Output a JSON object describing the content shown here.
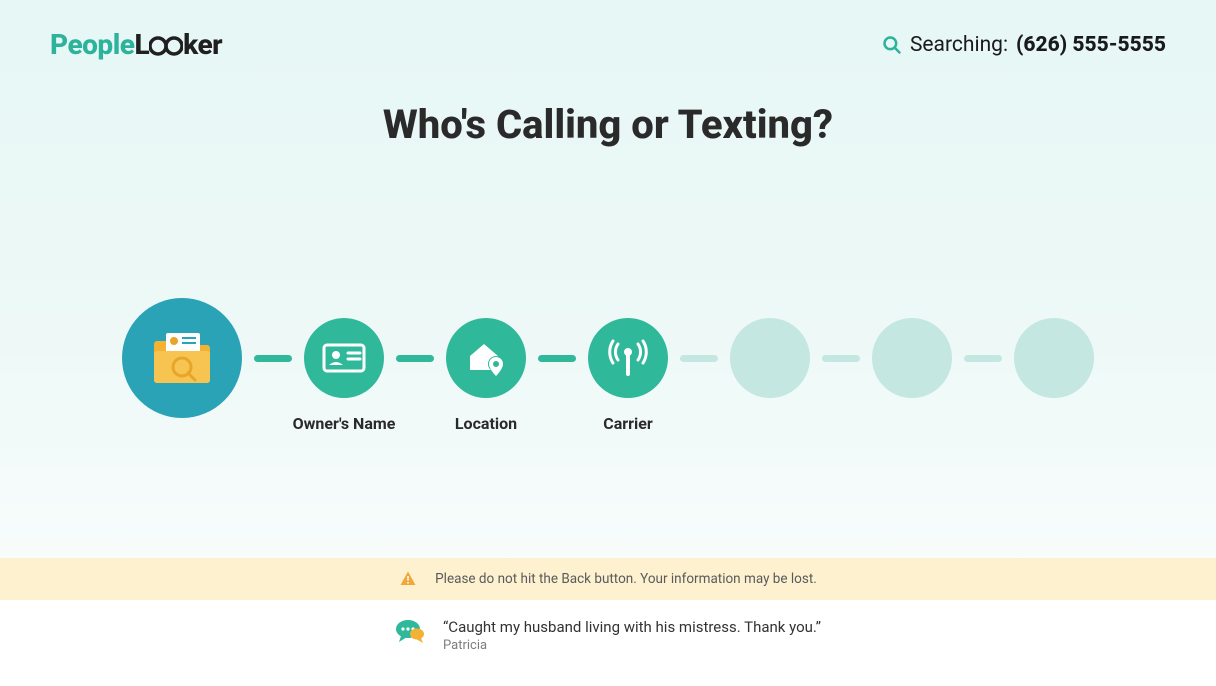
{
  "logo": {
    "part1": "People",
    "part2": "L",
    "part3": "ker"
  },
  "header": {
    "searching_label": "Searching:",
    "searching_number": "(626) 555-5555"
  },
  "page_title": "Who's Calling or Texting?",
  "steps": [
    {
      "label": ""
    },
    {
      "label": "Owner's Name"
    },
    {
      "label": "Location"
    },
    {
      "label": "Carrier"
    },
    {
      "label": ""
    },
    {
      "label": ""
    },
    {
      "label": ""
    }
  ],
  "banner": {
    "text": "Please do not hit the Back button. Your information may be lost."
  },
  "testimonial": {
    "quote": "“Caught my husband living with his mistress. Thank you.”",
    "author": "Patricia"
  }
}
